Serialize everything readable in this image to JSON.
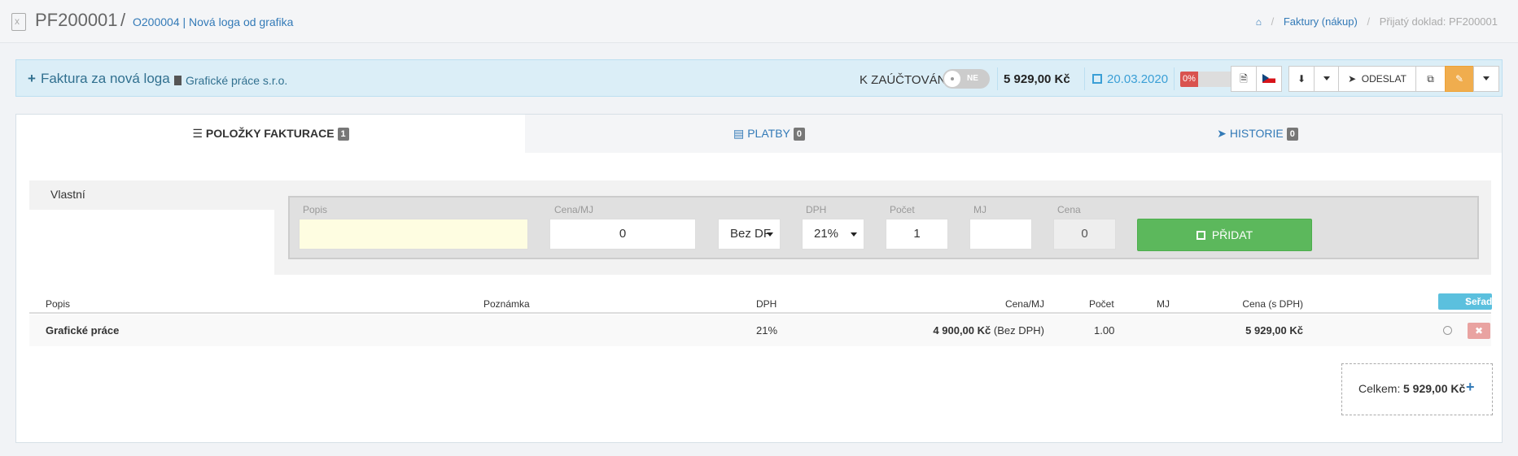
{
  "header": {
    "title": "PF200001",
    "separator": "/",
    "subtitle": "O200004 | Nová loga od grafika",
    "breadcrumb": {
      "home_icon": "home-icon",
      "sep": "/",
      "link": "Faktury (nákup)",
      "active": "Přijatý doklad: PF200001"
    }
  },
  "infobar": {
    "plus": "+",
    "title": "Faktura za nová loga",
    "company": "Grafické práce s.r.o.",
    "posting_label": "K ZAÚČTOVÁNÍ",
    "toggle_text": "NE",
    "amount": "5 929,00 Kč",
    "date": "20.03.2020",
    "progress_text": "0%",
    "progress_value": 0,
    "send_label": "ODESLAT"
  },
  "tabs": [
    {
      "label": "POLOŽKY FAKTURACE",
      "count": "1"
    },
    {
      "label": "PLATBY",
      "count": "0"
    },
    {
      "label": "HISTORIE",
      "count": "0"
    }
  ],
  "form": {
    "section_label": "Vlastní",
    "labels": {
      "popis": "Popis",
      "cena_mj": "Cena/MJ",
      "dph": "DPH",
      "pocet": "Počet",
      "mj": "MJ",
      "cena": "Cena"
    },
    "values": {
      "popis": "",
      "cena_mj": "0",
      "tax_mode": "Bez DF",
      "dph": "21%",
      "pocet": "1",
      "mj": "",
      "cena": "0"
    },
    "add_label": "PŘIDAT"
  },
  "table": {
    "headers": {
      "popis": "Popis",
      "poznamka": "Poznámka",
      "dph": "DPH",
      "cena_mj": "Cena/MJ",
      "pocet": "Počet",
      "mj": "MJ",
      "cena_s_dph": "Cena (s DPH)"
    },
    "sort_label": "Seřadit",
    "rows": [
      {
        "popis": "Grafické práce",
        "poznamka": "",
        "dph": "21%",
        "cena_mj": "4 900,00 Kč",
        "cena_mj_note": "(Bez DPH)",
        "pocet": "1.00",
        "mj": "",
        "cena_s_dph": "5 929,00 Kč"
      }
    ],
    "delete_label": "✖"
  },
  "total": {
    "label": "Celkem:",
    "value": "5 929,00 Kč",
    "plus": "+"
  },
  "colors": {
    "accent": "#337ab7",
    "info_bg": "#dbeef7",
    "success": "#5cb85c",
    "danger": "#d9534f",
    "warning": "#f0ad4e",
    "sort": "#5bc0de"
  }
}
